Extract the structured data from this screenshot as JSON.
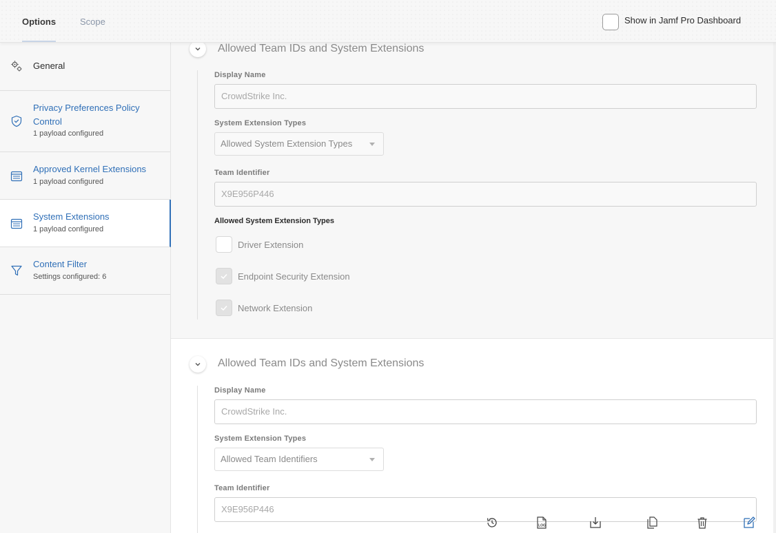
{
  "header": {
    "tabs": [
      {
        "label": "Options",
        "active": true
      },
      {
        "label": "Scope",
        "active": false
      }
    ],
    "dashboard_checkbox": {
      "label": "Show in Jamf Pro Dashboard",
      "checked": false
    }
  },
  "sidebar": {
    "items": [
      {
        "label": "General",
        "sub": "",
        "icon": "gear-icon",
        "active": false
      },
      {
        "label": "Privacy Preferences Policy Control",
        "sub": "1 payload configured",
        "icon": "shield-icon",
        "active": false
      },
      {
        "label": "Approved Kernel Extensions",
        "sub": "1 payload configured",
        "icon": "extension-icon",
        "active": false
      },
      {
        "label": "System Extensions",
        "sub": "1 payload configured",
        "icon": "extension-icon",
        "active": true
      },
      {
        "label": "Content Filter",
        "sub": "Settings configured: 6",
        "icon": "filter-icon",
        "active": false
      }
    ]
  },
  "sections": [
    {
      "title": "Allowed Team IDs and System Extensions",
      "display_name_label": "Display Name",
      "display_name_value": "CrowdStrike Inc.",
      "types_label": "System Extension Types",
      "types_value": "Allowed System Extension Types",
      "team_id_label": "Team Identifier",
      "team_id_value": "X9E956P446",
      "allowed_types_title": "Allowed System Extension Types",
      "allowed_types": [
        {
          "label": "Driver Extension",
          "checked": false
        },
        {
          "label": "Endpoint Security Extension",
          "checked": true
        },
        {
          "label": "Network Extension",
          "checked": true
        }
      ]
    },
    {
      "title": "Allowed Team IDs and System Extensions",
      "display_name_label": "Display Name",
      "display_name_value": "CrowdStrike Inc.",
      "types_label": "System Extension Types",
      "types_value": "Allowed Team Identifiers",
      "team_id_label": "Team Identifier",
      "team_id_value": "X9E956P446"
    }
  ],
  "toolbar": {
    "icons": [
      "history-icon",
      "log-icon",
      "download-icon",
      "clone-icon",
      "trash-icon",
      "edit-icon"
    ],
    "log_text": "LOG"
  },
  "colors": {
    "accent": "#2f6fb7",
    "sidebar_bg": "#f7f7f7",
    "muted_text": "#8a8a8a"
  }
}
